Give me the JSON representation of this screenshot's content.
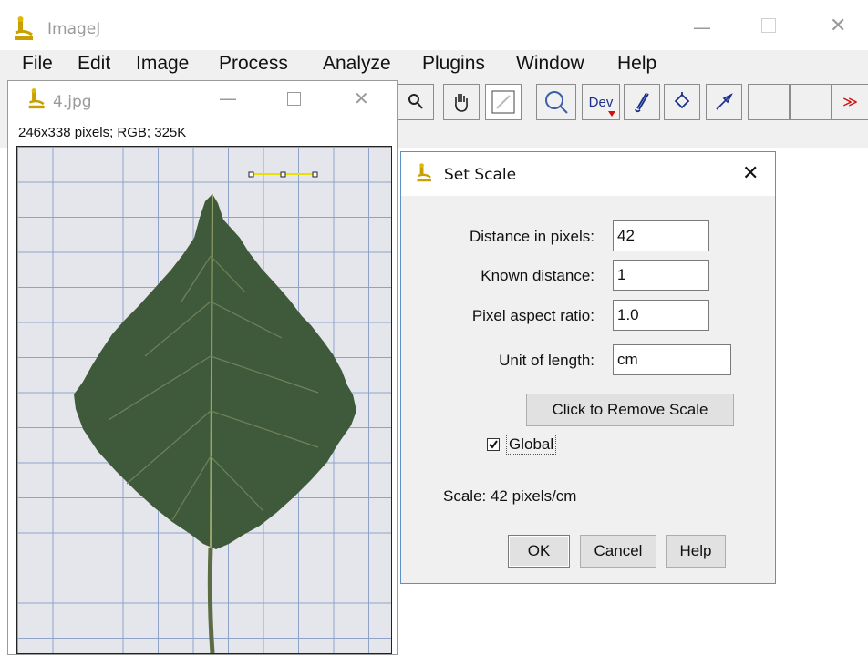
{
  "main_window": {
    "title": "ImageJ",
    "menu": [
      "File",
      "Edit",
      "Image",
      "Process",
      "Analyze",
      "Plugins",
      "Window",
      "Help"
    ],
    "toolbar": {
      "dev_label": "Dev",
      "more_label": "≫"
    }
  },
  "image_window": {
    "title": "4.jpg",
    "info": "246x338 pixels; RGB; 325K"
  },
  "dialog": {
    "title": "Set Scale",
    "fields": [
      {
        "label": "Distance in pixels:",
        "value": "42"
      },
      {
        "label": "Known distance:",
        "value": "1"
      },
      {
        "label": "Pixel aspect ratio:",
        "value": "1.0"
      },
      {
        "label": "Unit of length:",
        "value": "cm"
      }
    ],
    "remove_scale_button": "Click to Remove Scale",
    "global_checkbox": {
      "label": "Global",
      "checked": true
    },
    "scale_text": "Scale: 42 pixels/cm",
    "buttons": {
      "ok": "OK",
      "cancel": "Cancel",
      "help": "Help"
    }
  },
  "colors": {
    "leaf": "#3f5a3a",
    "grid_line": "#8fa3c9",
    "paper": "#e4e6ec",
    "selection_line": "#e8e000",
    "dialog_border": "#5f8fc7",
    "dev_arrow": "#d01010",
    "more_arrow": "#d01010"
  }
}
